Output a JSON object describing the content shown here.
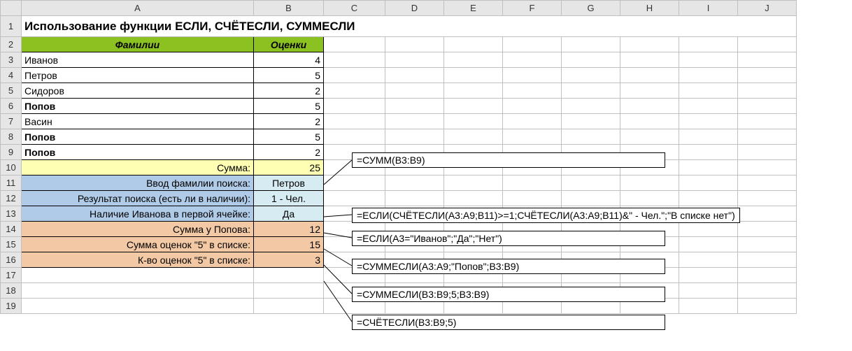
{
  "columns": [
    "A",
    "B",
    "C",
    "D",
    "E",
    "F",
    "G",
    "H",
    "I",
    "J"
  ],
  "title": "Использование функции ЕСЛИ, СЧЁТЕСЛИ, СУММЕСЛИ",
  "headers": {
    "surname": "Фамилии",
    "grades": "Оценки"
  },
  "students": [
    {
      "name": "Иванов",
      "grade": 4,
      "bold": false
    },
    {
      "name": "Петров",
      "grade": 5,
      "bold": false
    },
    {
      "name": "Сидоров",
      "grade": 2,
      "bold": false
    },
    {
      "name": "Попов",
      "grade": 5,
      "bold": true
    },
    {
      "name": "Васин",
      "grade": 2,
      "bold": false
    },
    {
      "name": "Попов",
      "grade": 5,
      "bold": true
    },
    {
      "name": "Попов",
      "grade": 2,
      "bold": true
    }
  ],
  "rows": {
    "sum": {
      "label": "Сумма:",
      "value": 25
    },
    "input_surname": {
      "label": "Ввод фамилии поиска:",
      "value": "Петров"
    },
    "search_result": {
      "label": "Результат поиска (есть ли в наличии):",
      "value": "1 - Чел."
    },
    "ivanov_first": {
      "label": "Наличие Иванова в первой ячейке:",
      "value": "Да"
    },
    "sum_popov": {
      "label": "Сумма у Попова:",
      "value": 12
    },
    "sum_grade5": {
      "label": "Сумма оценок \"5\" в списке:",
      "value": 15
    },
    "count_grade5": {
      "label": "К-во оценок \"5\" в списке:",
      "value": 3
    }
  },
  "formulas": {
    "f1": "=СУММ(B3:B9)",
    "f2": "=ЕСЛИ(СЧЁТЕСЛИ(A3:A9;B11)>=1;СЧЁТЕСЛИ(A3:A9;B11)&\" - Чел.\";\"В списке нет\")",
    "f3": "=ЕСЛИ(A3=\"Иванов\";\"Да\";\"Нет\")",
    "f4": "=СУММЕСЛИ(A3:A9;\"Попов\";B3:B9)",
    "f5": "=СУММЕСЛИ(B3:B9;5;B3:B9)",
    "f6": "=СЧЁТЕСЛИ(B3:B9;5)"
  },
  "chart_data": {
    "type": "table",
    "title": "Использование функции ЕСЛИ, СЧЁТЕСЛИ, СУММЕСЛИ",
    "columns": [
      "Фамилии",
      "Оценки"
    ],
    "rows": [
      [
        "Иванов",
        4
      ],
      [
        "Петров",
        5
      ],
      [
        "Сидоров",
        2
      ],
      [
        "Попов",
        5
      ],
      [
        "Васин",
        2
      ],
      [
        "Попов",
        5
      ],
      [
        "Попов",
        2
      ]
    ],
    "aggregates": {
      "Сумма": 25,
      "Сумма у Попова": 12,
      "Сумма оценок 5": 15,
      "К-во оценок 5": 3
    }
  }
}
